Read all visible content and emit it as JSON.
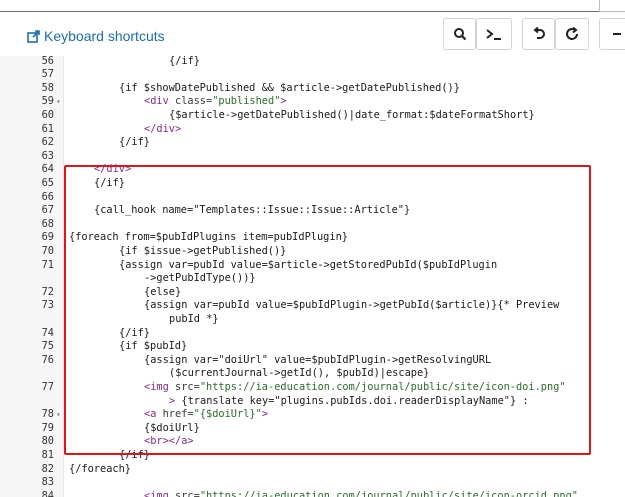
{
  "header": {
    "shortcuts_label": "Keyboard shortcuts",
    "accent": "#1a6eb0"
  },
  "toolbar": {
    "buttons": [
      {
        "name": "search-button",
        "icon": "search-icon"
      },
      {
        "name": "terminal-button",
        "icon": "terminal-icon"
      },
      {
        "name": "undo-button",
        "icon": "undo-icon"
      },
      {
        "name": "redo-button",
        "icon": "redo-icon"
      },
      {
        "name": "more-button",
        "icon": "arrow-left-icon"
      }
    ]
  },
  "highlight_color": "#e01616",
  "editor": {
    "lines": [
      {
        "num": "56",
        "fold": false,
        "cont": false,
        "indent": 4,
        "segments": [
          {
            "t": "{/if}",
            "c": "plain"
          }
        ]
      },
      {
        "num": "57",
        "fold": false,
        "cont": false,
        "indent": 0,
        "segments": []
      },
      {
        "num": "58",
        "fold": false,
        "cont": false,
        "indent": 2,
        "segments": [
          {
            "t": "{if $showDatePublished && $article->getDatePublished()}",
            "c": "plain"
          }
        ]
      },
      {
        "num": "59",
        "fold": true,
        "cont": false,
        "indent": 3,
        "segments": [
          {
            "t": "<div ",
            "c": "tag"
          },
          {
            "t": "class=",
            "c": "attr"
          },
          {
            "t": "\"published\"",
            "c": "str"
          },
          {
            "t": ">",
            "c": "tag"
          }
        ]
      },
      {
        "num": "60",
        "fold": false,
        "cont": false,
        "indent": 4,
        "segments": [
          {
            "t": "{$article->getDatePublished()|date_format:$dateFormatShort}",
            "c": "plain"
          }
        ]
      },
      {
        "num": "61",
        "fold": false,
        "cont": false,
        "indent": 3,
        "segments": [
          {
            "t": "</div>",
            "c": "tag"
          }
        ]
      },
      {
        "num": "62",
        "fold": false,
        "cont": false,
        "indent": 2,
        "segments": [
          {
            "t": "{/if}",
            "c": "plain"
          }
        ]
      },
      {
        "num": "63",
        "fold": false,
        "cont": false,
        "indent": 0,
        "segments": []
      },
      {
        "num": "64",
        "fold": false,
        "cont": false,
        "indent": 1,
        "segments": [
          {
            "t": "</div>",
            "c": "tag"
          }
        ]
      },
      {
        "num": "65",
        "fold": false,
        "cont": false,
        "indent": 1,
        "segments": [
          {
            "t": "{/if}",
            "c": "plain"
          }
        ]
      },
      {
        "num": "66",
        "fold": false,
        "cont": false,
        "indent": 0,
        "segments": []
      },
      {
        "num": "67",
        "fold": false,
        "cont": false,
        "indent": 1,
        "segments": [
          {
            "t": "{call_hook name=\"Templates::Issue::Issue::Article\"}",
            "c": "plain"
          }
        ]
      },
      {
        "num": "68",
        "fold": false,
        "cont": false,
        "indent": 0,
        "segments": []
      },
      {
        "num": "69",
        "fold": false,
        "cont": false,
        "indent": 0,
        "segments": [
          {
            "t": "{foreach from=$pubIdPlugins item=pubIdPlugin}",
            "c": "plain"
          }
        ]
      },
      {
        "num": "70",
        "fold": false,
        "cont": false,
        "indent": 2,
        "segments": [
          {
            "t": "{if $issue->getPublished()}",
            "c": "plain"
          }
        ]
      },
      {
        "num": "71",
        "fold": false,
        "cont": false,
        "indent": 2,
        "segments": [
          {
            "t": "{assign var=pubId value=$article->getStoredPubId($pubIdPlugin",
            "c": "plain"
          }
        ]
      },
      {
        "num": "",
        "fold": false,
        "cont": true,
        "indent": 3,
        "segments": [
          {
            "t": "->getPubIdType())}",
            "c": "plain"
          }
        ]
      },
      {
        "num": "72",
        "fold": false,
        "cont": false,
        "indent": 3,
        "segments": [
          {
            "t": "{else}",
            "c": "plain"
          }
        ]
      },
      {
        "num": "73",
        "fold": false,
        "cont": false,
        "indent": 3,
        "segments": [
          {
            "t": "{assign var=pubId value=$pubIdPlugin->getPubId($article)}{* Preview",
            "c": "plain"
          }
        ]
      },
      {
        "num": "",
        "fold": false,
        "cont": true,
        "indent": 4,
        "segments": [
          {
            "t": "pubId *}",
            "c": "plain"
          }
        ]
      },
      {
        "num": "74",
        "fold": false,
        "cont": false,
        "indent": 2,
        "segments": [
          {
            "t": "{/if}",
            "c": "plain"
          }
        ]
      },
      {
        "num": "75",
        "fold": false,
        "cont": false,
        "indent": 2,
        "segments": [
          {
            "t": "{if $pubId}",
            "c": "plain"
          }
        ]
      },
      {
        "num": "76",
        "fold": false,
        "cont": false,
        "indent": 3,
        "segments": [
          {
            "t": "{assign var=\"doiUrl\" value=$pubIdPlugin->getResolvingURL",
            "c": "plain"
          }
        ]
      },
      {
        "num": "",
        "fold": false,
        "cont": true,
        "indent": 4,
        "segments": [
          {
            "t": "($currentJournal->getId(), $pubId)|escape}",
            "c": "plain"
          }
        ]
      },
      {
        "num": "77",
        "fold": false,
        "cont": false,
        "indent": 3,
        "segments": [
          {
            "t": "<img ",
            "c": "tag"
          },
          {
            "t": "src=",
            "c": "attr"
          },
          {
            "t": "\"https://ia-education.com/journal/public/site/icon-doi.png\"",
            "c": "str"
          }
        ]
      },
      {
        "num": "",
        "fold": false,
        "cont": true,
        "indent": 4,
        "segments": [
          {
            "t": "> ",
            "c": "tag"
          },
          {
            "t": "{translate key=\"plugins.pubIds.doi.readerDisplayName\"} :",
            "c": "plain"
          }
        ]
      },
      {
        "num": "78",
        "fold": true,
        "cont": false,
        "indent": 3,
        "segments": [
          {
            "t": "<a ",
            "c": "tag"
          },
          {
            "t": "href=",
            "c": "attr"
          },
          {
            "t": "\"{$doiUrl}\"",
            "c": "str"
          },
          {
            "t": ">",
            "c": "tag"
          }
        ]
      },
      {
        "num": "79",
        "fold": false,
        "cont": false,
        "indent": 3,
        "segments": [
          {
            "t": "{$doiUrl}",
            "c": "plain"
          }
        ]
      },
      {
        "num": "80",
        "fold": false,
        "cont": false,
        "indent": 3,
        "segments": [
          {
            "t": "<br></a>",
            "c": "tag"
          }
        ]
      },
      {
        "num": "81",
        "fold": false,
        "cont": false,
        "indent": 2,
        "segments": [
          {
            "t": "{/if}",
            "c": "plain"
          }
        ]
      },
      {
        "num": "82",
        "fold": false,
        "cont": false,
        "indent": 0,
        "segments": [
          {
            "t": "{/foreach}",
            "c": "plain"
          }
        ]
      },
      {
        "num": "83",
        "fold": false,
        "cont": false,
        "indent": 0,
        "segments": []
      },
      {
        "num": "84",
        "fold": false,
        "cont": false,
        "indent": 3,
        "segments": [
          {
            "t": "<img ",
            "c": "tag"
          },
          {
            "t": "src=",
            "c": "attr"
          },
          {
            "t": "\"https://ia-education.com/journal/public/site/icon-orcid.png\"",
            "c": "str"
          }
        ]
      }
    ]
  }
}
